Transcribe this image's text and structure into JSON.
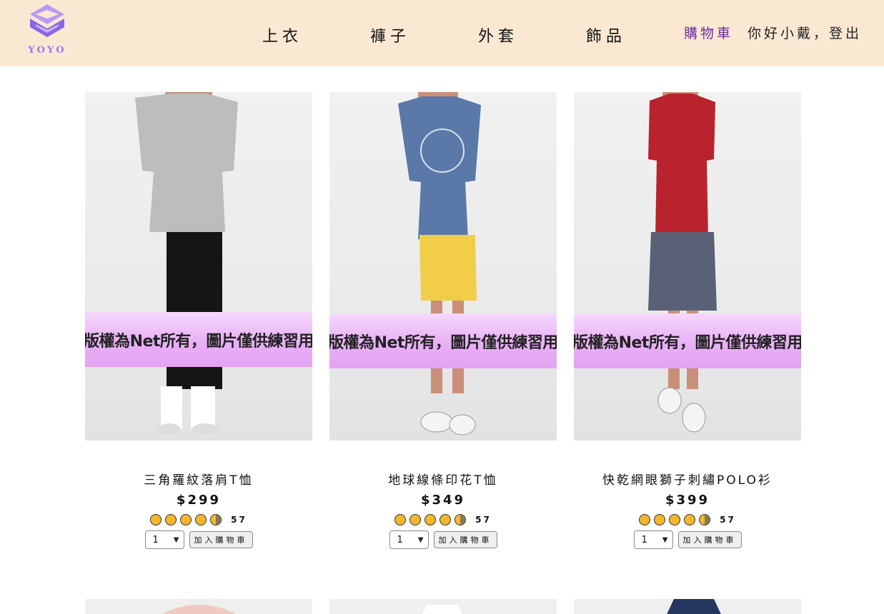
{
  "header": {
    "logo_text": "YOYO",
    "nav": [
      "上衣",
      "褲子",
      "外套",
      "飾品"
    ],
    "cart_label": "購物車",
    "greeting": "你好小戴，",
    "logout_label": "登出"
  },
  "products": [
    {
      "name": "三角羅紋落肩T恤",
      "price": "$299",
      "rating": 4.5,
      "rating_count": "57",
      "quantity": "1",
      "add_label": "加入購物車",
      "watermark": "版權為Net所有，圖片僅供練習用",
      "shirt_color": "#bdbdbd",
      "pants_color": "#151515"
    },
    {
      "name": "地球線條印花T恤",
      "price": "$349",
      "rating": 4.5,
      "rating_count": "57",
      "quantity": "1",
      "add_label": "加入購物車",
      "watermark": "版權為Net所有，圖片僅供練習用",
      "shirt_color": "#5a78a8",
      "pants_color": "#f2cd48"
    },
    {
      "name": "快乾網眼獅子刺繡POLO衫",
      "price": "$399",
      "rating": 4.5,
      "rating_count": "57",
      "quantity": "1",
      "add_label": "加入購物車",
      "watermark": "版權為Net所有，圖片僅供練習用",
      "shirt_color": "#b8232d",
      "pants_color": "#5a6075"
    }
  ],
  "colors": {
    "header_bg": "#fbe8d3",
    "cart_link": "#6b2fa0",
    "logo": "#9b7bea",
    "star": "#f4b62b"
  }
}
